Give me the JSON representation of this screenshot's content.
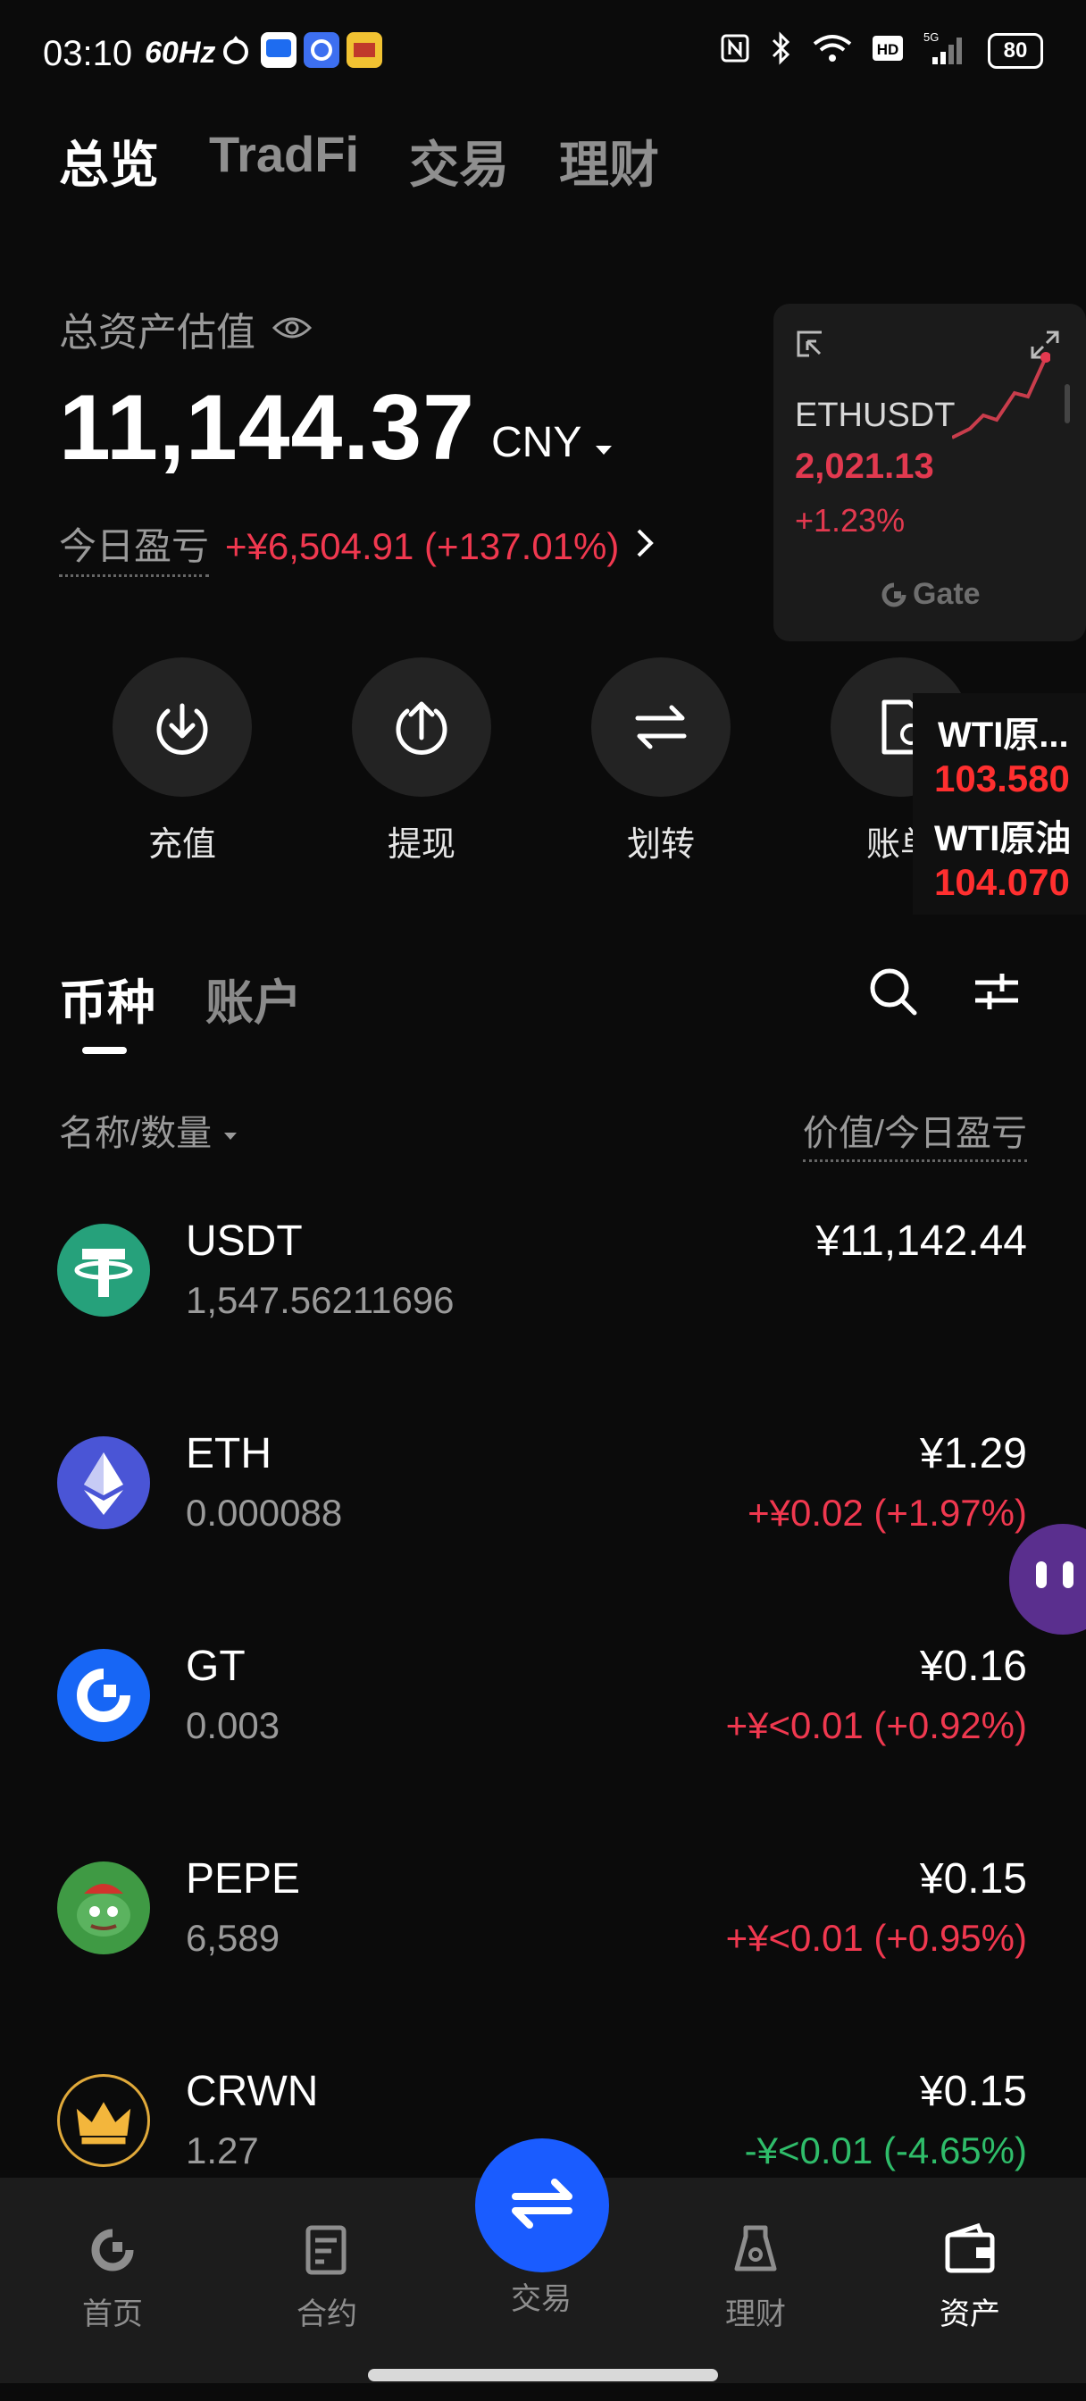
{
  "status_bar": {
    "time": "03:10",
    "refresh": "60Hz",
    "battery": "80",
    "network": "5G"
  },
  "top_tabs": [
    "总览",
    "TradFi",
    "交易",
    "理财"
  ],
  "summary": {
    "label": "总资产估值",
    "amount": "11,144.37",
    "currency": "CNY",
    "pnl_label": "今日盈亏",
    "pnl_value": "+¥6,504.91 (+137.01%)"
  },
  "ticker_card": {
    "pair": "ETHUSDT",
    "price": "2,021.13",
    "change": "+1.23%",
    "brand": "Gate"
  },
  "actions": [
    {
      "label": "充值",
      "icon": "deposit-icon"
    },
    {
      "label": "提现",
      "icon": "withdraw-icon"
    },
    {
      "label": "划转",
      "icon": "transfer-icon"
    },
    {
      "label": "账单",
      "icon": "bill-icon"
    }
  ],
  "oil_overlay": [
    {
      "name": "WTI原...",
      "price": "103.580"
    },
    {
      "name": "WTI原油",
      "price": "104.070"
    }
  ],
  "section_tabs": [
    "币种",
    "账户"
  ],
  "columns": {
    "left": "名称/数量",
    "right": "价值/今日盈亏"
  },
  "assets": [
    {
      "symbol": "USDT",
      "quantity": "1,547.56211696",
      "value": "¥11,142.44",
      "pnl": ""
    },
    {
      "symbol": "ETH",
      "quantity": "0.000088",
      "value": "¥1.29",
      "pnl": "+¥0.02 (+1.97%)"
    },
    {
      "symbol": "GT",
      "quantity": "0.003",
      "value": "¥0.16",
      "pnl": "+¥<0.01 (+0.92%)"
    },
    {
      "symbol": "PEPE",
      "quantity": "6,589",
      "value": "¥0.15",
      "pnl": "+¥<0.01 (+0.95%)"
    },
    {
      "symbol": "CRWN",
      "quantity": "1.27",
      "value": "¥0.15",
      "pnl": "-¥<0.01 (-4.65%)"
    }
  ],
  "bottom_nav": [
    {
      "label": "首页"
    },
    {
      "label": "合约"
    },
    {
      "label": "交易"
    },
    {
      "label": "理财"
    },
    {
      "label": "资产"
    }
  ],
  "colors": {
    "up": "#f0384f",
    "down": "#2fbd6a",
    "accent": "#1a5cff",
    "background": "#0b0b0b"
  }
}
